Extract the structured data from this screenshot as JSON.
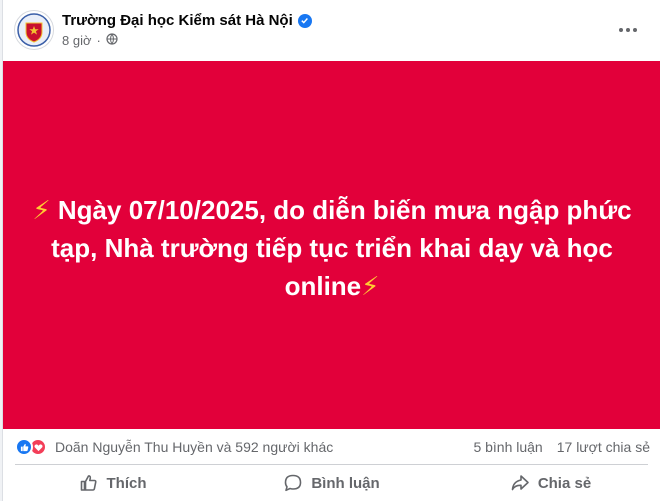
{
  "post": {
    "page_name": "Trường Đại học Kiểm sát Hà Nội",
    "time": "8 giờ",
    "separator": "·"
  },
  "banner": {
    "bolt": "⚡",
    "text_line": "Ngày 07/10/2025, do diễn biến mưa ngập phức tạp, Nhà trường tiếp tục triển khai dạy và học online",
    "background_color": "#e2003a"
  },
  "reactions": {
    "reactors": "Doãn Nguyễn Thu Huyền và 592 người khác",
    "comments": "5 bình luận",
    "shares": "17 lượt chia sẻ"
  },
  "actions": {
    "like": "Thích",
    "comment": "Bình luận",
    "share": "Chia sẻ"
  },
  "colors": {
    "accent": "#1877f2",
    "love": "#f33e58",
    "muted_text": "#65676b"
  }
}
